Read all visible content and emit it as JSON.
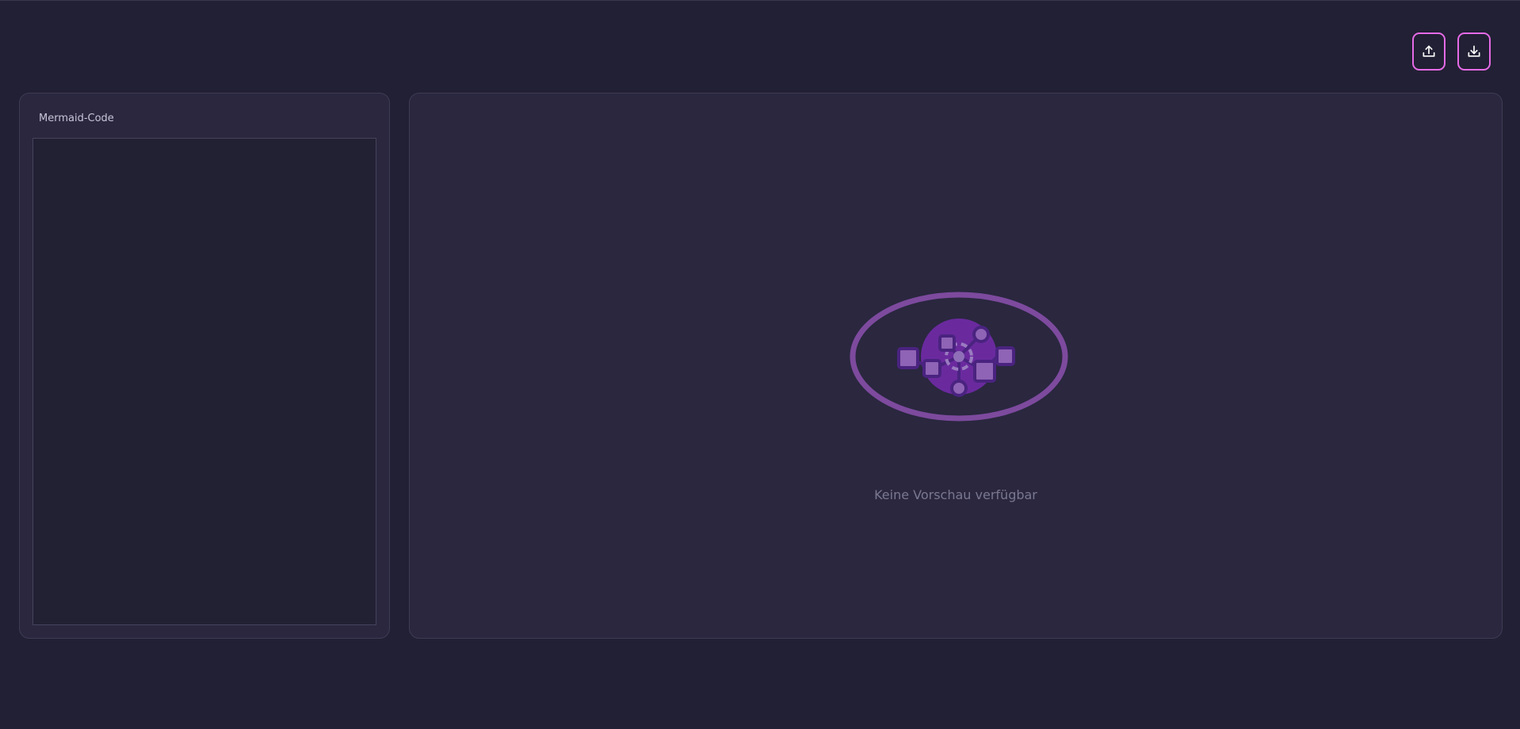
{
  "toolbar": {
    "upload_icon": "upload-icon",
    "download_icon": "download-icon",
    "accent_color": "#e56ae6"
  },
  "code_panel": {
    "title": "Mermaid-Code",
    "code_value": ""
  },
  "preview_panel": {
    "empty_icon": "diagram-network-icon",
    "empty_message": "Keine Vorschau verfügbar"
  },
  "colors": {
    "background": "#222034",
    "panel": "#2a273f",
    "illustration_primary": "#7a3fb0",
    "illustration_ring": "#8a4fa8"
  }
}
